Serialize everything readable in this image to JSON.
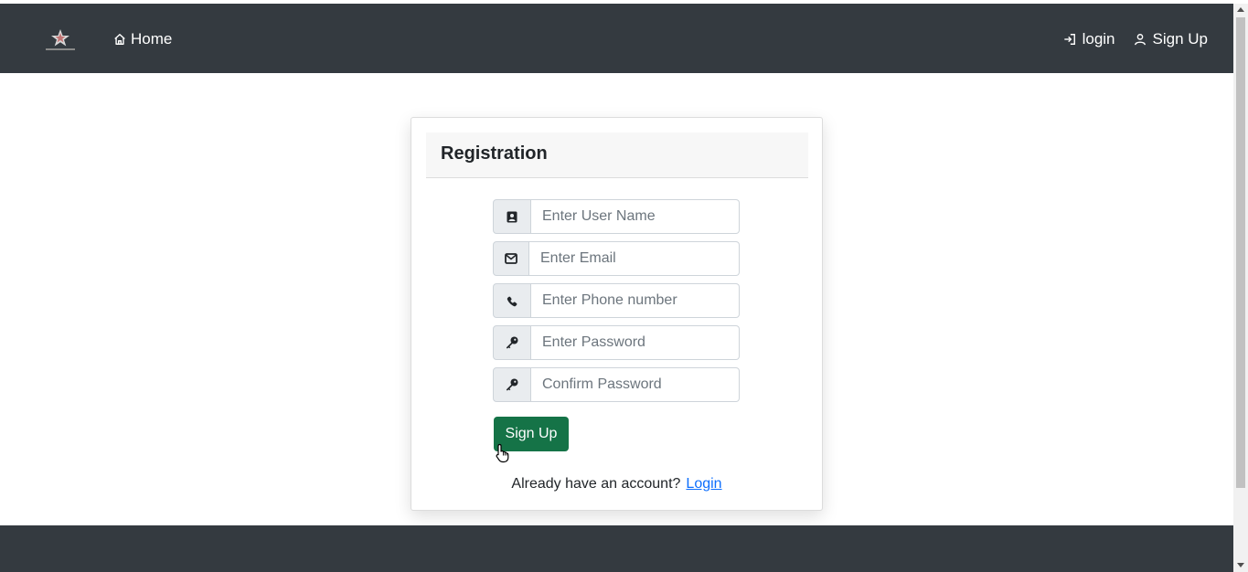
{
  "nav": {
    "home_label": "Home",
    "login_label": "login",
    "signup_label": "Sign Up"
  },
  "card": {
    "title": "Registration"
  },
  "form": {
    "username_placeholder": "Enter User Name",
    "email_placeholder": "Enter Email",
    "phone_placeholder": "Enter Phone number",
    "password_placeholder": "Enter Password",
    "confirm_placeholder": "Confirm Password",
    "submit_label": "Sign Up"
  },
  "footer_text": {
    "question": "Already have an account?",
    "login_link": "Login"
  },
  "icons": {
    "home": "home-icon",
    "login": "login-icon",
    "signup": "user-icon",
    "username": "id-badge-icon",
    "email": "envelope-icon",
    "phone": "phone-icon",
    "password": "key-icon",
    "confirm": "key-icon"
  },
  "colors": {
    "navbar": "#343a40",
    "button": "#157347",
    "link": "#0d6efd"
  }
}
